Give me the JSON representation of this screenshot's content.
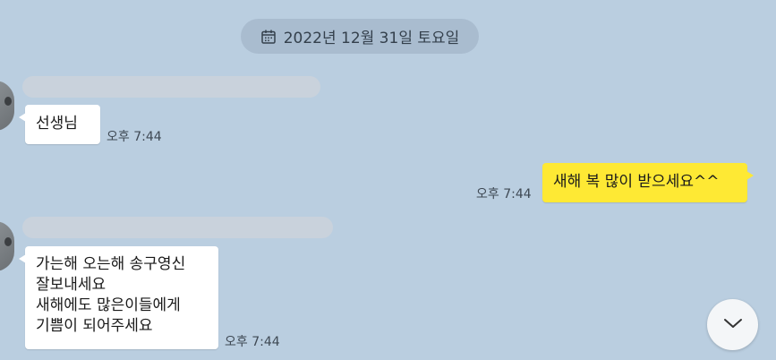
{
  "date_divider": {
    "text": "2022년 12월 31일 토요일",
    "icon": "calendar-icon"
  },
  "messages": [
    {
      "direction": "incoming",
      "text": "선생님",
      "time": "오후 7:44"
    },
    {
      "direction": "outgoing",
      "text": "새해 복 많이 받으세요^^",
      "time": "오후 7:44"
    },
    {
      "direction": "incoming",
      "lines": [
        "가는해 오는해 송구영신",
        "잘보내세요",
        "새해에도 많은이들에게",
        "기쁨이 되어주세요"
      ],
      "time": "오후 7:44"
    }
  ],
  "scroll_button": {
    "icon": "chevron-down-icon"
  },
  "colors": {
    "background": "#bacee0",
    "incoming_bubble": "#ffffff",
    "outgoing_bubble": "#fee934",
    "date_pill": "#a9bccf"
  }
}
